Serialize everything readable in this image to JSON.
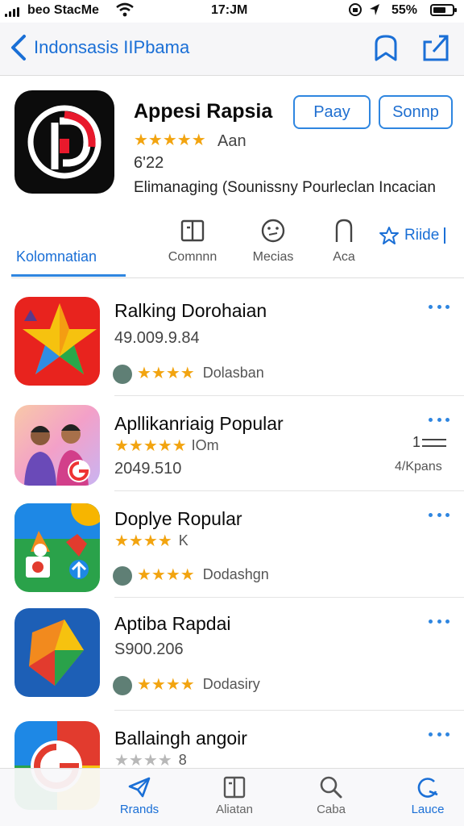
{
  "status_bar": {
    "carrier": "beo StacMe",
    "time": "17:JM",
    "battery": "55%"
  },
  "nav": {
    "title": "Indonsasis IIPbama"
  },
  "app": {
    "name": "Appesi Rapsia",
    "play_button": "Paay",
    "second_button": "Sonnp",
    "rating_text": "Aan",
    "size": "6'22",
    "description": "Elimanaging (Sounissny Pourleclan Incacian"
  },
  "tabs": {
    "active": "Kolomnatian",
    "comments": "Comnnn",
    "media": "Mecias",
    "access": "Aca",
    "rate": "Riide"
  },
  "list": [
    {
      "name": "Ralking Dorohaian",
      "meta": "49.009.9.84",
      "rating_label": "Dolasban"
    },
    {
      "name": "Apllikanriaig Popular",
      "meta_top": "IOm",
      "meta": "2049.510",
      "side_meta_top": "1",
      "side_meta": "4/Kpans"
    },
    {
      "name": "Doplye Ropular",
      "meta_top": "K",
      "rating_label": "Dodashgn"
    },
    {
      "name": "Aptiba Rapdai",
      "meta": "S900.206",
      "rating_label": "Dodasiry"
    },
    {
      "name": "Ballaingh angoir",
      "meta_top": "8"
    }
  ],
  "tabbar": {
    "items": [
      "Rrands",
      "Aliatan",
      "Caba",
      "Lauce"
    ]
  },
  "colors": {
    "accent": "#1a6fd6",
    "star": "#f2a410"
  }
}
